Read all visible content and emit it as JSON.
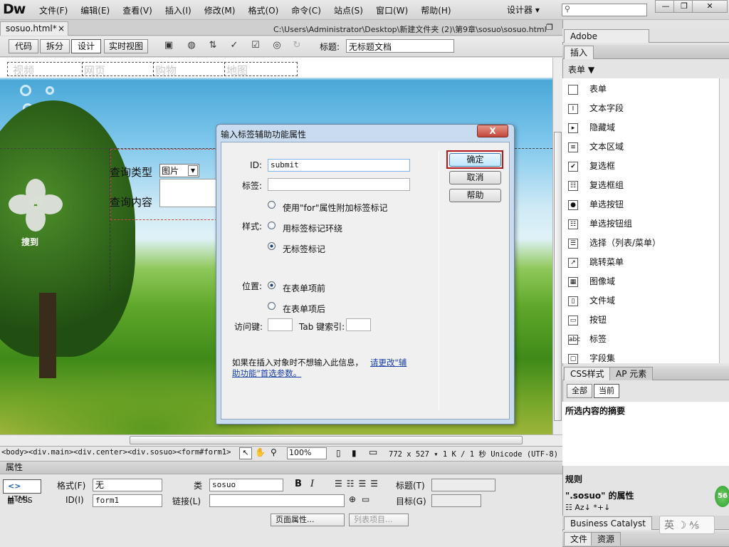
{
  "app": {
    "logo": "Dw",
    "menu": [
      "文件(F)",
      "编辑(E)",
      "查看(V)",
      "插入(I)",
      "修改(M)",
      "格式(O)",
      "命令(C)",
      "站点(S)",
      "窗口(W)",
      "帮助(H)"
    ],
    "workspace": "设计器 ▾",
    "window_min": "—",
    "window_max": "❐",
    "window_close": "✕"
  },
  "document": {
    "tab_label": "sosuo.html*",
    "tab_close": "×",
    "path": "C:\\Users\\Administrator\\Desktop\\新建文件夹 (2)\\第9章\\sosuo\\sosuo.html",
    "view_buttons": [
      "代码",
      "拆分",
      "设计",
      "实时视图"
    ],
    "active_view": "设计",
    "title_label": "标题:",
    "title_value": "无标题文档"
  },
  "design": {
    "nav": [
      "视频",
      "网页",
      "购物",
      "地图"
    ],
    "logo_text": "搜到",
    "query_type_label": "查询类型",
    "query_type_value": "图片",
    "query_content_label": "查询内容"
  },
  "status": {
    "tag_selector": "<body><div.main><div.center><div.sosuo><form#form1>",
    "zoom": "100%",
    "dims": "772 x 527 ▾ 1 K / 1 秒  Unicode (UTF-8)"
  },
  "properties": {
    "title": "属性",
    "html_btn": "HTML",
    "css_btn": "CSS",
    "format_label": "格式(F)",
    "format_value": "无",
    "class_label": "类",
    "class_value": "sosuo",
    "bold": "B",
    "italic": "I",
    "heading_label": "标题(T)",
    "id_label": "ID(I)",
    "id_value": "form1",
    "link_label": "链接(L)",
    "target_label": "目标(G)",
    "page_props": "页面属性...",
    "list_item": "列表项目..."
  },
  "right": {
    "browserlab": "Adobe BrowserLab",
    "insert_tab": "插入",
    "category": "表单 ▼",
    "items": [
      {
        "icon": "form-icon",
        "glyph": "",
        "label": "表单"
      },
      {
        "icon": "text-field-icon",
        "glyph": "I",
        "label": "文本字段"
      },
      {
        "icon": "hidden-field-icon",
        "glyph": "▸",
        "label": "隐藏域"
      },
      {
        "icon": "textarea-icon",
        "glyph": "≡",
        "label": "文本区域"
      },
      {
        "icon": "checkbox-icon",
        "glyph": "✔",
        "label": "复选框"
      },
      {
        "icon": "checkbox-group-icon",
        "glyph": "☷",
        "label": "复选框组"
      },
      {
        "icon": "radio-icon",
        "glyph": "●",
        "label": "单选按钮"
      },
      {
        "icon": "radio-group-icon",
        "glyph": "☷",
        "label": "单选按钮组"
      },
      {
        "icon": "select-icon",
        "glyph": "☰",
        "label": "选择（列表/菜单）"
      },
      {
        "icon": "jump-menu-icon",
        "glyph": "↗",
        "label": "跳转菜单"
      },
      {
        "icon": "image-field-icon",
        "glyph": "▦",
        "label": "图像域"
      },
      {
        "icon": "file-field-icon",
        "glyph": "▯",
        "label": "文件域"
      },
      {
        "icon": "button-icon",
        "glyph": "▭",
        "label": "按钮"
      },
      {
        "icon": "label-icon",
        "glyph": "abc",
        "label": "标签"
      },
      {
        "icon": "fieldset-icon",
        "glyph": "▢",
        "label": "字段集"
      }
    ],
    "css_tab": "CSS样式",
    "ap_tab": "AP 元素",
    "all_btn": "全部",
    "current_btn": "当前",
    "summary": "所选内容的摘要",
    "rules": "规则",
    "rule_props": "\".sosuo\" 的属性",
    "bc": "Business Catalyst",
    "file_tab": "文件",
    "assets_tab": "资源",
    "badge": "56"
  },
  "dialog": {
    "title": "输入标签辅助功能属性",
    "close": "X",
    "id_label": "ID:",
    "id_value": "submit",
    "label_label": "标签:",
    "style_label": "样式:",
    "opt_for": "使用\"for\"属性附加标签标记",
    "opt_wrap": "用标签标记环绕",
    "opt_none": "无标签标记",
    "position_label": "位置:",
    "opt_before": "在表单项前",
    "opt_after": "在表单项后",
    "access_key": "访问键:",
    "tab_index": "Tab 键索引:",
    "ok": "确定",
    "cancel": "取消",
    "help": "帮助",
    "note": "如果在插入对象时不想输入此信息，",
    "link1": "请更改\"辅",
    "link2": "助功能\"首选参数。"
  },
  "ime": "英 ☽ ⅍"
}
